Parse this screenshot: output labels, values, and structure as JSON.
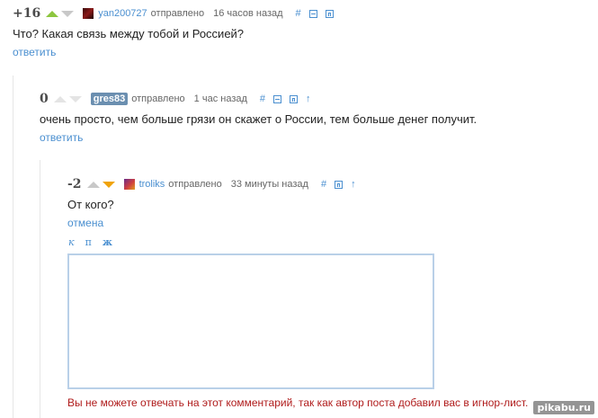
{
  "comments": [
    {
      "rating": "+16",
      "user": "yan200727",
      "sent": "отправлено",
      "time": "16 часов назад",
      "text": "Что? Какая связь между тобой и Россией?",
      "action": "ответить"
    },
    {
      "rating": "0",
      "user": "gres83",
      "sent": "отправлено",
      "time": "1 час назад",
      "text": "очень просто, чем больше грязи он скажет о России, тем больше денег получит.",
      "action": "ответить"
    },
    {
      "rating": "-2",
      "user": "troliks",
      "sent": "отправлено",
      "time": "33 минуты назад",
      "text": "От кого?",
      "action": "отмена"
    }
  ],
  "icons": {
    "hash": "#",
    "up": "↑"
  },
  "format_bar": {
    "italic": "к",
    "underline": "п",
    "bold": "ж"
  },
  "reply_box": {
    "value": ""
  },
  "error_message": "Вы не можете отвечать на этот комментарий, так как автор поста добавил вас в игнор-лист.",
  "watermark": "pikabu.ru",
  "colors": {
    "link": "#4a8fd0",
    "upvote": "#8dc63f",
    "downvote": "#f0a30a",
    "error": "#b01c1c"
  }
}
